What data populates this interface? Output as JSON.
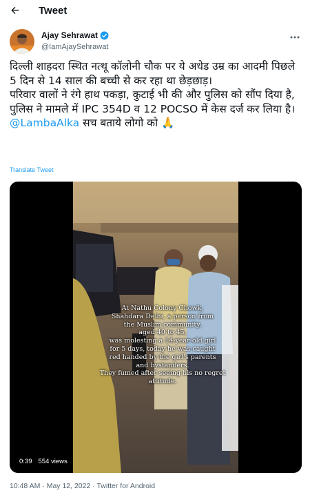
{
  "header": {
    "title": "Tweet",
    "back_icon": "arrow-left-icon"
  },
  "author": {
    "name": "Ajay Sehrawat",
    "handle": "@IamAjaySehrawat",
    "verified": true,
    "more_icon": "more-dots-icon"
  },
  "tweet": {
    "paragraph1": "दिल्ली शाहदरा स्थित नत्थू कॉलोनी चौक पर ये अधेड उम्र का आदमी पिछले 5 दिन से 14 साल की बच्ची से कर रहा था छेड़छाड़।",
    "paragraph2": "परिवार वालों ने रंगे हाथ पकड़ा, कुटाई भी की और पुलिस को सौंप दिया है, पुलिस ने मामले में IPC 354D व 12 POCSO में केस दर्ज कर लिया है।",
    "mention": "@LambaAlka",
    "closing": " सच बताये लोगो को 🙏",
    "translate_label": "Translate Tweet"
  },
  "media": {
    "caption_lines": [
      "At Nathu Colony Chowk,",
      "Shahdara Delhi, a person from",
      "the Muslim community,",
      "aged 40 to 45,",
      "was molesting a 14-year-old girl",
      "for 5 days, today he was caught",
      "red handed by the girl's parents",
      "and bystanders.",
      "They fumed after seeing his no regret attitude."
    ],
    "duration": "0:39",
    "views": "554 views"
  },
  "meta": {
    "timestamp": "10:48 AM · May 12, 2022 · Twitter for Android"
  },
  "colors": {
    "link": "#1d9bf0",
    "secondary_text": "#536471",
    "verified": "#1d9bf0"
  }
}
